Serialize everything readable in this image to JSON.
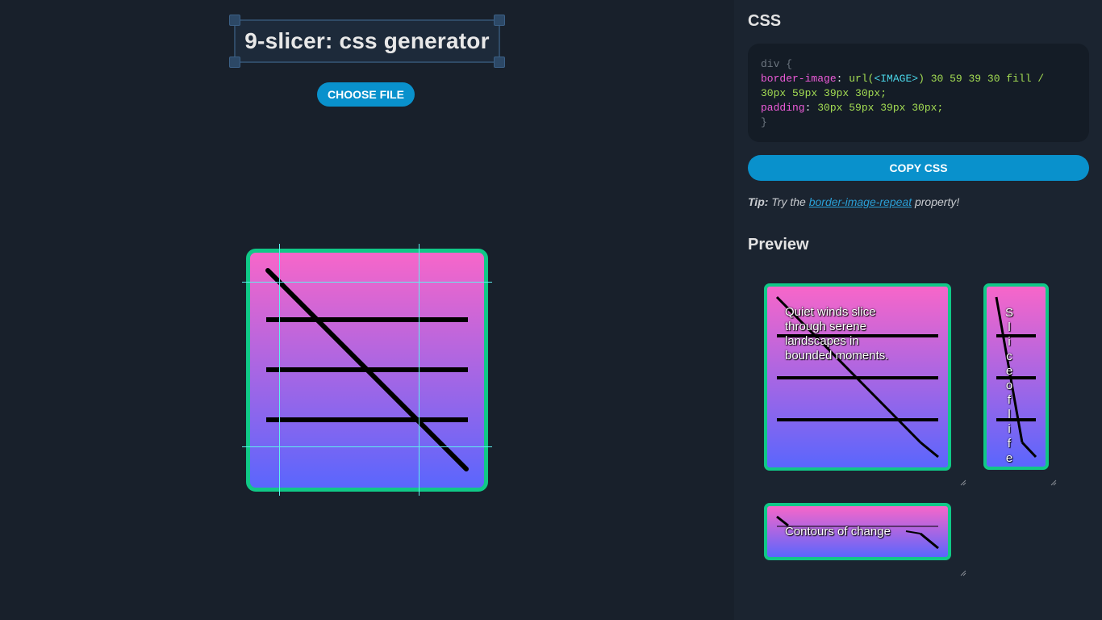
{
  "header": {
    "title": "9-slicer: css generator",
    "choose_file_label": "CHOOSE FILE"
  },
  "css_panel": {
    "title": "CSS",
    "code": {
      "selector_open": "div {",
      "border_image_prop": "border-image",
      "url_open": "url(",
      "image_token": "<IMAGE>",
      "url_close": ")",
      "slice_values": "30 59 39 30 fill /",
      "width_values": "30px 59px 39px 30px;",
      "padding_prop": "padding",
      "padding_values": "30px 59px 39px 30px;",
      "close": "}"
    },
    "copy_label": "COPY CSS",
    "tip": {
      "label": "Tip:",
      "prefix": "Try the",
      "link": "border-image-repeat",
      "suffix": "property!"
    }
  },
  "preview": {
    "title": "Preview",
    "box1_text": "Quiet winds slice through serene landscapes in bounded moments.",
    "box2_letters": [
      "S",
      "l",
      "i",
      "c",
      "e",
      "o",
      "f",
      "l",
      "i",
      "f",
      "e"
    ],
    "box3_text": "Contours of change"
  },
  "colors": {
    "accent_blue": "#0991cc",
    "border_green": "#10c887",
    "gradient_top": "#f766c9",
    "gradient_bottom": "#5a66fd",
    "guide_cyan": "#5ff0ee"
  }
}
